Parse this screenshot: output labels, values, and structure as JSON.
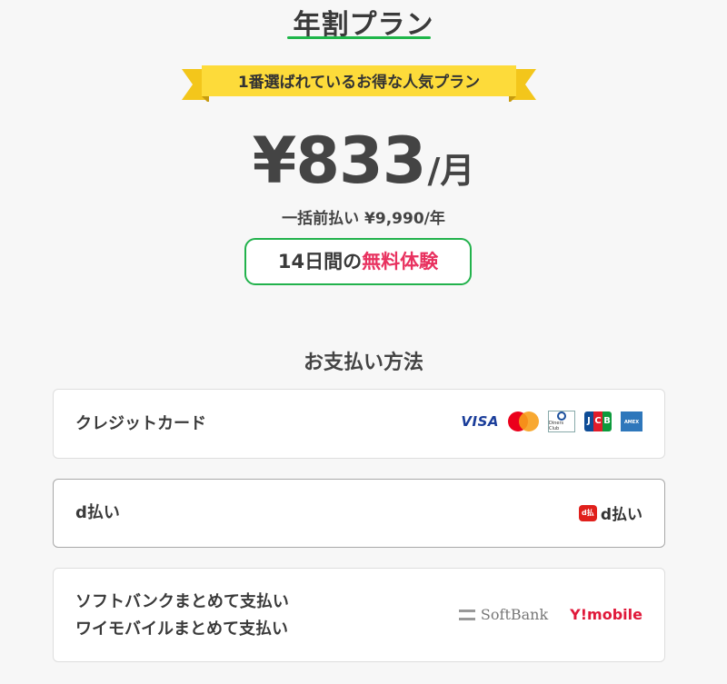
{
  "plan": {
    "title": "年割プラン",
    "ribbon": "1番選ばれているお得な人気プラン",
    "price": "¥833",
    "price_unit": "/月",
    "lump_sum": "一括前払い ¥9,990/年",
    "trial_prefix": "14日間の",
    "trial_highlight": "無料体験"
  },
  "payment": {
    "heading": "お支払い方法",
    "methods": [
      {
        "label": "クレジットカード",
        "logos": [
          "VISA",
          "mastercard-icon",
          "Diners Club",
          "JCB",
          "AMERICAN EXPRESS"
        ]
      },
      {
        "label": "d払い",
        "logo_badge": "d払い",
        "logo_text": "d払い"
      },
      {
        "label_line1": "ソフトバンクまとめて支払い",
        "label_line2": "ワイモバイルまとめて支払い",
        "logo_softbank": "SoftBank",
        "logo_ymobile": "Y!mobile"
      }
    ]
  },
  "colors": {
    "accent_green": "#1fb64a",
    "ribbon_yellow": "#fdd835",
    "highlight_pink": "#e8315f"
  }
}
